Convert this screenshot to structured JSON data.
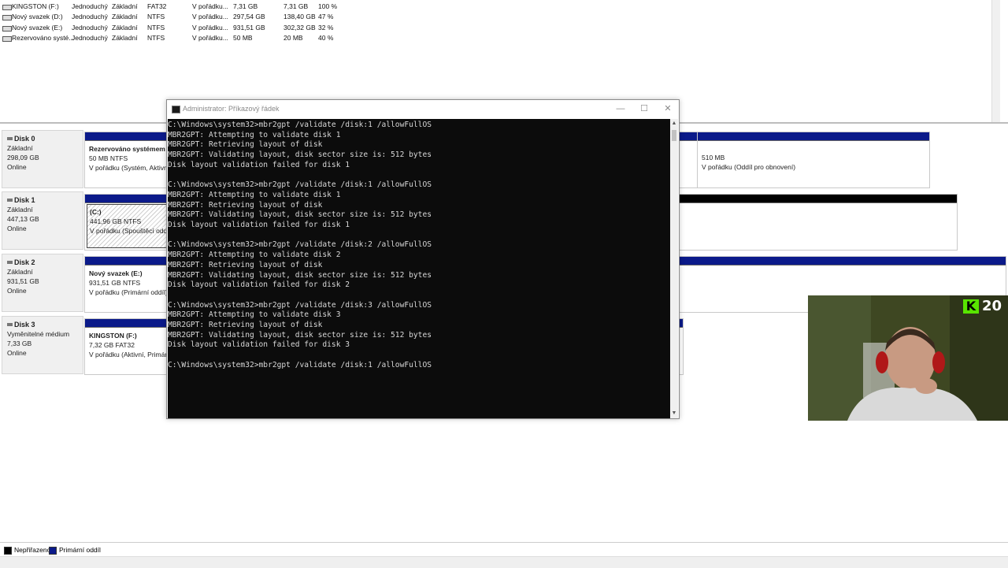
{
  "volumes": [
    {
      "name": "KINGSTON (F:)",
      "layout": "Jednoduchý",
      "type": "Základní",
      "fs": "FAT32",
      "status": "V pořádku...",
      "capacity": "7,31 GB",
      "free": "7,31 GB",
      "pct": "100 %"
    },
    {
      "name": "Nový svazek (D:)",
      "layout": "Jednoduchý",
      "type": "Základní",
      "fs": "NTFS",
      "status": "V pořádku...",
      "capacity": "297,54 GB",
      "free": "138,40 GB",
      "pct": "47 %"
    },
    {
      "name": "Nový svazek (E:)",
      "layout": "Jednoduchý",
      "type": "Základní",
      "fs": "NTFS",
      "status": "V pořádku...",
      "capacity": "931,51 GB",
      "free": "302,32 GB",
      "pct": "32 %"
    },
    {
      "name": "Rezervováno systé...",
      "layout": "Jednoduchý",
      "type": "Základní",
      "fs": "NTFS",
      "status": "V pořádku...",
      "capacity": "50 MB",
      "free": "20 MB",
      "pct": "40 %"
    }
  ],
  "disks": [
    {
      "name": "Disk 0",
      "type": "Základní",
      "size": "298,09 GB",
      "state": "Online",
      "p1": {
        "name": "Rezervováno systémem",
        "size": "50 MB NTFS",
        "status": "V pořádku (Systém, Aktivní,"
      },
      "p2": {
        "size": "510 MB",
        "status": "V pořádku (Oddíl pro obnovení)"
      }
    },
    {
      "name": "Disk 1",
      "type": "Základní",
      "size": "447,13 GB",
      "state": "Online",
      "p1": {
        "name": "(C:)",
        "size": "441,96 GB NTFS",
        "status": "V pořádku (Spouštěcí oddíl,"
      }
    },
    {
      "name": "Disk 2",
      "type": "Základní",
      "size": "931,51 GB",
      "state": "Online",
      "p1": {
        "name": "Nový svazek (E:)",
        "size": "931,51 GB NTFS",
        "status": "V pořádku (Primární oddíl)"
      }
    },
    {
      "name": "Disk 3",
      "type": "Vyměnitelné médium",
      "size": "7,33 GB",
      "state": "Online",
      "p1": {
        "name": "KINGSTON (F:)",
        "size": "7,32 GB FAT32",
        "status": "V pořádku (Aktivní, Primární"
      }
    }
  ],
  "legend": {
    "unallocated": "Nepřiřazeno",
    "primary": "Primární oddíl"
  },
  "cmd": {
    "title": "Administrator: Příkazový řádek",
    "minimize": "—",
    "maximize": "☐",
    "close": "✕",
    "lines": [
      "C:\\Windows\\system32>mbr2gpt /validate /disk:1 /allowFullOS",
      "MBR2GPT: Attempting to validate disk 1",
      "MBR2GPT: Retrieving layout of disk",
      "MBR2GPT: Validating layout, disk sector size is: 512 bytes",
      "Disk layout validation failed for disk 1",
      "",
      "C:\\Windows\\system32>mbr2gpt /validate /disk:1 /allowFullOS",
      "MBR2GPT: Attempting to validate disk 1",
      "MBR2GPT: Retrieving layout of disk",
      "MBR2GPT: Validating layout, disk sector size is: 512 bytes",
      "Disk layout validation failed for disk 1",
      "",
      "C:\\Windows\\system32>mbr2gpt /validate /disk:2 /allowFullOS",
      "MBR2GPT: Attempting to validate disk 2",
      "MBR2GPT: Retrieving layout of disk",
      "MBR2GPT: Validating layout, disk sector size is: 512 bytes",
      "Disk layout validation failed for disk 2",
      "",
      "C:\\Windows\\system32>mbr2gpt /validate /disk:3 /allowFullOS",
      "MBR2GPT: Attempting to validate disk 3",
      "MBR2GPT: Retrieving layout of disk",
      "MBR2GPT: Validating layout, disk sector size is: 512 bytes",
      "Disk layout validation failed for disk 3",
      "",
      "C:\\Windows\\system32>mbr2gpt /validate /disk:1 /allowFullOS"
    ]
  },
  "webcam": {
    "badge_letter": "K",
    "badge_number": "20"
  },
  "colors": {
    "primary_partition": "#0b1a8a",
    "unallocated": "#000000",
    "console_bg": "#0c0c0c",
    "badge": "#58e400"
  }
}
